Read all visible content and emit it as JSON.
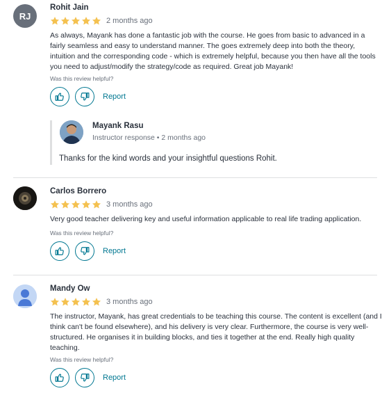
{
  "colors": {
    "accent": "#007791",
    "star": "#f4c150",
    "text": "#29303b",
    "muted": "#686f7a"
  },
  "reviews": [
    {
      "initials": "RJ",
      "name": "Rohit Jain",
      "rating": 5,
      "date": "2 months ago",
      "text": "As always, Mayank has done a fantastic job with the course. He goes from basic to advanced in a fairly seamless and easy to understand manner. The goes extremely deep into both the theory, intuition and the corresponding code - which is extremely helpful, because you then have all the tools you need to adjust/modify the strategy/code as required. Great job Mayank!",
      "helpful_prompt": "Was this review helpful?",
      "report_label": "Report",
      "response": {
        "name": "Mayank Rasu",
        "meta": "Instructor response • 2 months ago",
        "text": "Thanks for the kind words and your insightful questions Rohit."
      }
    },
    {
      "name": "Carlos Borrero",
      "rating": 5,
      "date": "3 months ago",
      "text": "Very good teacher delivering key and useful information applicable to real life trading application.",
      "helpful_prompt": "Was this review helpful?",
      "report_label": "Report"
    },
    {
      "name": "Mandy Ow",
      "rating": 5,
      "date": "3 months ago",
      "text": "The instructor, Mayank, has great credentials to be teaching this course. The content is excellent (and I think can't be found elsewhere), and his delivery is very clear. Furthermore, the course is very well-structured. He organises it in building blocks, and ties it together at the end. Really high quality teaching.",
      "helpful_prompt": "Was this review helpful?",
      "report_label": "Report"
    }
  ]
}
